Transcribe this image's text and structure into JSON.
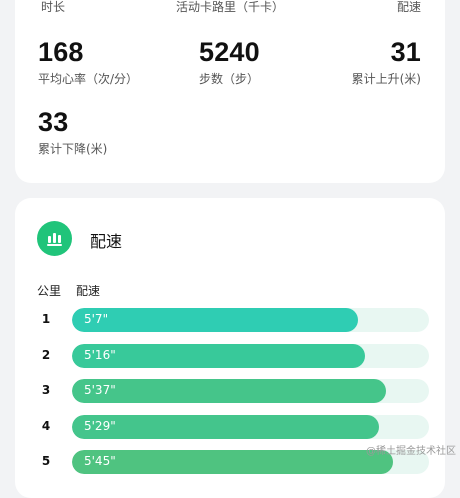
{
  "summary": {
    "header_labels": [
      "时长",
      "活动卡路里（千卡）",
      "配速"
    ],
    "stats": [
      {
        "value": "168",
        "label": "平均心率（次/分）"
      },
      {
        "value": "5240",
        "label": "步数（步）"
      },
      {
        "value": "31",
        "label": "累计上升(米)"
      },
      {
        "value": "33",
        "label": "累计下降(米)"
      }
    ]
  },
  "pace": {
    "title": "配速",
    "icon": "bar-chart-icon",
    "columns": {
      "km": "公里",
      "pace": "配速"
    },
    "rows": [
      {
        "km": "1",
        "pace": "5'7\"",
        "fraction": 0.8,
        "color": "#2fcdb3"
      },
      {
        "km": "2",
        "pace": "5'16\"",
        "fraction": 0.82,
        "color": "#38c99a"
      },
      {
        "km": "3",
        "pace": "5'37\"",
        "fraction": 0.88,
        "color": "#45c58a"
      },
      {
        "km": "4",
        "pace": "5'29\"",
        "fraction": 0.86,
        "color": "#44c58c"
      },
      {
        "km": "5",
        "pace": "5'45\"",
        "fraction": 0.9,
        "color": "#4fc380"
      }
    ]
  },
  "watermark": "@稀土掘金技术社区",
  "colors": {
    "accent": "#20c47a",
    "track": "#e8f7f2",
    "background": "#f2f3f5"
  }
}
